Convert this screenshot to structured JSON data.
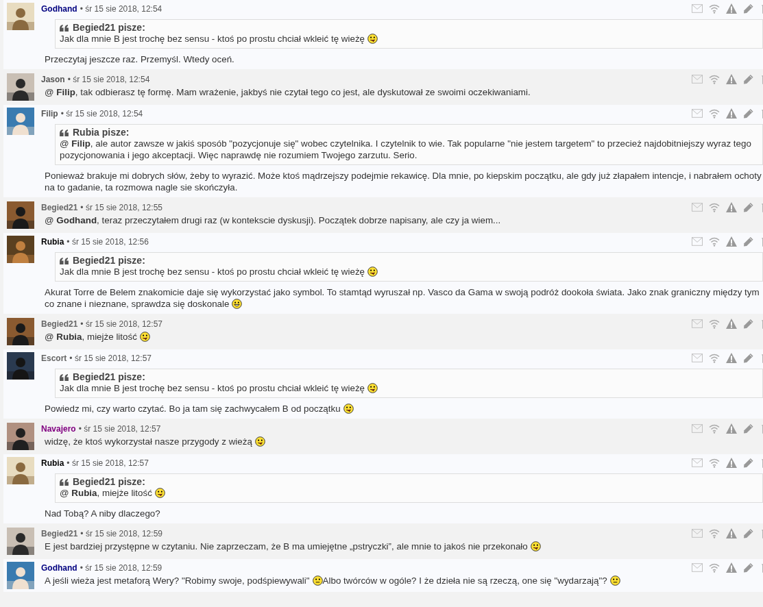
{
  "posts": [
    {
      "author": "Godhand",
      "color": "#000080",
      "date": "• śr 15 sie 2018, 12:54",
      "quote": {
        "title": "Begied21 pisze:",
        "body": [
          {
            "kind": "text",
            "text": "Jak dla mnie B jest trochę bez sensu - ktoś po prostu chciał wkleić tę wieżę"
          },
          {
            "kind": "tongue"
          }
        ]
      },
      "body": [
        {
          "kind": "text",
          "text": "Przeczytaj jeszcze raz. Przemyśl. Wtedy oceń."
        }
      ]
    },
    {
      "author": "Jason",
      "color": "#555555",
      "date": "• śr 15 sie 2018, 12:54",
      "body": [
        {
          "kind": "text",
          "text": "@ **Filip**, tak odbierasz tę formę. Mam wrażenie, jakbyś nie czytał tego co jest, ale dyskutował ze swoimi oczekiwaniami."
        }
      ]
    },
    {
      "author": "Filip",
      "color": "#555555",
      "date": "• śr 15 sie 2018, 12:54",
      "quote": {
        "title": "Rubia pisze:",
        "body": [
          {
            "kind": "text",
            "text": "@ **Filip**, ale autor zawsze w jakiś sposób \"pozycjonuje się\" wobec czytelnika. I czytelnik to wie. Tak popularne \"nie jestem targetem\" to przecież najdobitniejszy wyraz tego pozycjonowania i jego akceptacji. Więc naprawdę nie rozumiem Twojego zarzutu. Serio."
          }
        ]
      },
      "body": [
        {
          "kind": "text",
          "text": "Ponieważ brakuje mi dobrych słów, żeby to wyrazić. Może ktoś mądrzejszy podejmie rekawicę. Dla mnie, po kiepskim początku, ale gdy już złapałem intencje, i nabrałem ochoty na to gadanie, ta rozmowa nagle sie skończyła."
        }
      ]
    },
    {
      "author": "Begied21",
      "color": "#666666",
      "date": "• śr 15 sie 2018, 12:55",
      "body": [
        {
          "kind": "text",
          "text": "@ **Godhand**, teraz przeczytałem drugi raz (w kontekscie dyskusji). Początek dobrze napisany, ale czy ja wiem..."
        }
      ]
    },
    {
      "author": "Rubia",
      "color": "#000000",
      "date": "• śr 15 sie 2018, 12:56",
      "quote": {
        "title": "Begied21 pisze:",
        "body": [
          {
            "kind": "text",
            "text": "Jak dla mnie B jest trochę bez sensu - ktoś po prostu chciał wkleić tę wieżę"
          },
          {
            "kind": "tongue"
          }
        ]
      },
      "body": [
        {
          "kind": "text",
          "text": "Akurat Torre de Belem znakomicie daje się wykorzystać jako symbol. To stamtąd wyruszał np. Vasco da Gama w swoją podróż dookoła świata. Jako znak graniczny między tym co znane i nieznane, sprawdza się doskonale"
        },
        {
          "kind": "grin"
        }
      ]
    },
    {
      "author": "Begied21",
      "color": "#666666",
      "date": "• śr 15 sie 2018, 12:57",
      "body": [
        {
          "kind": "text",
          "text": "@ **Rubia**, miejże litość"
        },
        {
          "kind": "tongue"
        }
      ]
    },
    {
      "author": "Escort",
      "color": "#666666",
      "date": "• śr 15 sie 2018, 12:57",
      "quote": {
        "title": "Begied21 pisze:",
        "body": [
          {
            "kind": "text",
            "text": "Jak dla mnie B jest trochę bez sensu - ktoś po prostu chciał wkleić tę wieżę"
          },
          {
            "kind": "tongue"
          }
        ]
      },
      "body": [
        {
          "kind": "text",
          "text": "Powiedz mi, czy warto czytać. Bo ja tam się zachwycałem B od początku"
        },
        {
          "kind": "tongue"
        }
      ]
    },
    {
      "author": "Navajero",
      "color": "#800080",
      "date": "• śr 15 sie 2018, 12:57",
      "body": [
        {
          "kind": "text",
          "text": "widzę, że ktoś wykorzystał nasze przygody z wieżą"
        },
        {
          "kind": "tongue"
        }
      ]
    },
    {
      "author": "Rubia",
      "color": "#000000",
      "date": "• śr 15 sie 2018, 12:57",
      "quote": {
        "title": "Begied21 pisze:",
        "body": [
          {
            "kind": "text",
            "text": "@ **Rubia**, miejże litość"
          },
          {
            "kind": "tongue"
          }
        ]
      },
      "body": [
        {
          "kind": "text",
          "text": "Nad Tobą? A niby dlaczego?"
        }
      ]
    },
    {
      "author": "Begied21",
      "color": "#666666",
      "date": "• śr 15 sie 2018, 12:59",
      "body": [
        {
          "kind": "text",
          "text": "E jest bardziej przystępne w czytaniu. Nie zaprzeczam, że B ma umiejętne „pstryczki”, ale mnie to jakoś nie przekonało"
        },
        {
          "kind": "tongue"
        }
      ]
    },
    {
      "author": "Godhand",
      "color": "#000080",
      "date": "• śr 15 sie 2018, 12:59",
      "body": [
        {
          "kind": "text",
          "text": "A jeśli wieża jest metaforą Wery? \"Robimy swoje, podśpiewywali\""
        },
        {
          "kind": "neutral"
        },
        {
          "kind": "text",
          "text": "Albo twórców w ogóle? I że dzieła nie są rzeczą, one się \"wydarzają\"?"
        },
        {
          "kind": "neutral"
        }
      ]
    }
  ]
}
